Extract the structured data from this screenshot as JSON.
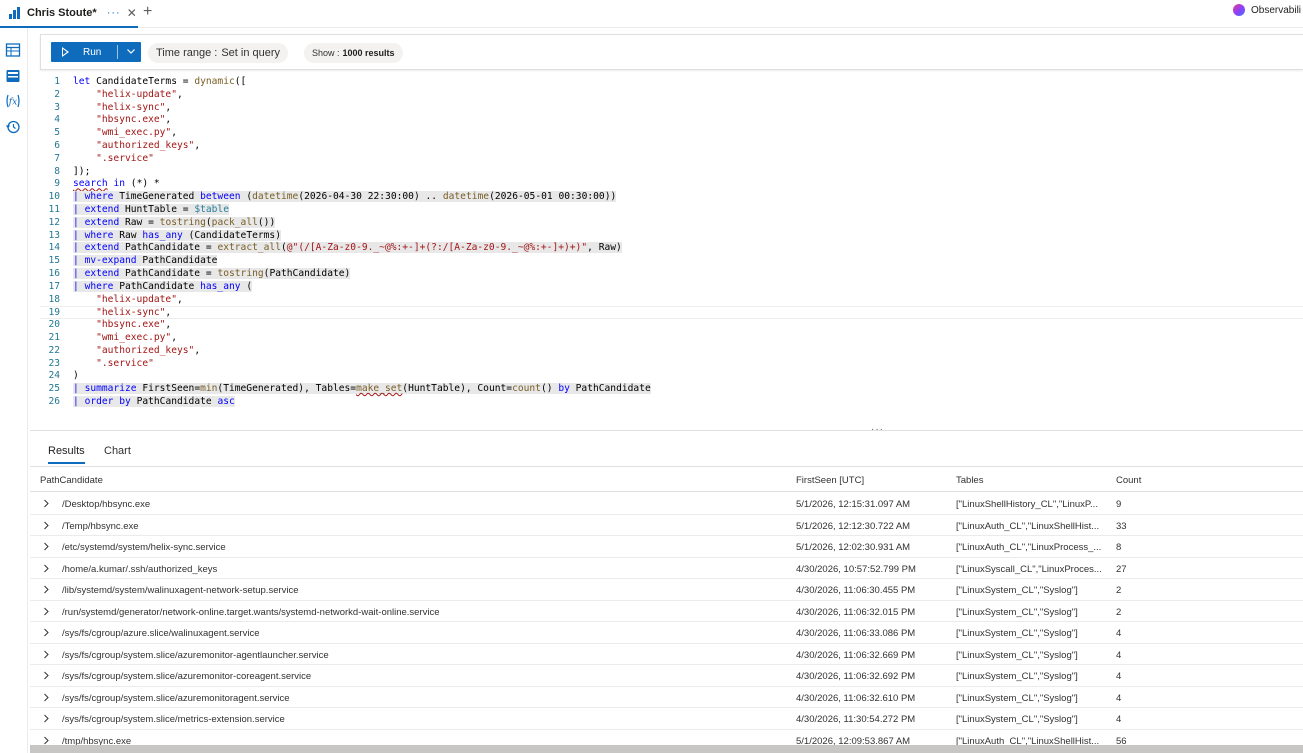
{
  "tab": {
    "title": "Chris Stoute*",
    "dots": "···",
    "close": "✕",
    "add": "+"
  },
  "brand": {
    "label": "Observabili",
    "accent": "#0f6cbd"
  },
  "rail": {
    "icons": [
      "table-icon",
      "storage-icon",
      "function-icon",
      "history-icon"
    ]
  },
  "toolbar": {
    "run_label": "Run",
    "time_range_label": "Time range :",
    "time_range_value": "Set in query",
    "show_label": "Show :",
    "show_value": "1000 results"
  },
  "editor": {
    "current_line": 19,
    "lines": [
      {
        "n": "1",
        "t": "let CandidateTerms = dynamic(["
      },
      {
        "n": "2",
        "t": "    \"helix-update\","
      },
      {
        "n": "3",
        "t": "    \"helix-sync\","
      },
      {
        "n": "4",
        "t": "    \"hbsync.exe\","
      },
      {
        "n": "5",
        "t": "    \"wmi_exec.py\","
      },
      {
        "n": "6",
        "t": "    \"authorized_keys\","
      },
      {
        "n": "7",
        "t": "    \".service\""
      },
      {
        "n": "8",
        "t": "]);"
      },
      {
        "n": "9",
        "t": "search in (*) *"
      },
      {
        "n": "10",
        "t": "| where TimeGenerated between (datetime(2026-04-30 22:30:00) .. datetime(2026-05-01 00:30:00))"
      },
      {
        "n": "11",
        "t": "| extend HuntTable = $table"
      },
      {
        "n": "12",
        "t": "| extend Raw = tostring(pack_all())"
      },
      {
        "n": "13",
        "t": "| where Raw has_any (CandidateTerms)"
      },
      {
        "n": "14",
        "t": "| extend PathCandidate = extract_all(@\"(/[A-Za-z0-9._~@%:+-]+(?:/[A-Za-z0-9._~@%:+-]+)+)\", Raw)"
      },
      {
        "n": "15",
        "t": "| mv-expand PathCandidate"
      },
      {
        "n": "16",
        "t": "| extend PathCandidate = tostring(PathCandidate)"
      },
      {
        "n": "17",
        "t": "| where PathCandidate has_any ("
      },
      {
        "n": "18",
        "t": "    \"helix-update\","
      },
      {
        "n": "19",
        "t": "    \"helix-sync\","
      },
      {
        "n": "20",
        "t": "    \"hbsync.exe\","
      },
      {
        "n": "21",
        "t": "    \"wmi_exec.py\","
      },
      {
        "n": "22",
        "t": "    \"authorized_keys\","
      },
      {
        "n": "23",
        "t": "    \".service\""
      },
      {
        "n": "24",
        "t": ")"
      },
      {
        "n": "25",
        "t": "| summarize FirstSeen=min(TimeGenerated), Tables=make_set(HuntTable), Count=count() by PathCandidate"
      },
      {
        "n": "26",
        "t": "| order by PathCandidate asc"
      }
    ]
  },
  "results": {
    "tabs": [
      "Results",
      "Chart"
    ],
    "active_tab": "Results",
    "splitter_dots": "···",
    "columns": [
      "PathCandidate",
      "FirstSeen [UTC]",
      "Tables",
      "Count"
    ],
    "rows": [
      [
        "/Desktop/hbsync.exe",
        "5/1/2026, 12:15:31.097 AM",
        "[\"LinuxShellHistory_CL\",\"LinuxP...",
        "9"
      ],
      [
        "/Temp/hbsync.exe",
        "5/1/2026, 12:12:30.722 AM",
        "[\"LinuxAuth_CL\",\"LinuxShellHist...",
        "33"
      ],
      [
        "/etc/systemd/system/helix-sync.service",
        "5/1/2026, 12:02:30.931 AM",
        "[\"LinuxAuth_CL\",\"LinuxProcess_...",
        "8"
      ],
      [
        "/home/a.kumar/.ssh/authorized_keys",
        "4/30/2026, 10:57:52.799 PM",
        "[\"LinuxSyscall_CL\",\"LinuxProces...",
        "27"
      ],
      [
        "/lib/systemd/system/walinuxagent-network-setup.service",
        "4/30/2026, 11:06:30.455 PM",
        "[\"LinuxSystem_CL\",\"Syslog\"]",
        "2"
      ],
      [
        "/run/systemd/generator/network-online.target.wants/systemd-networkd-wait-online.service",
        "4/30/2026, 11:06:32.015 PM",
        "[\"LinuxSystem_CL\",\"Syslog\"]",
        "2"
      ],
      [
        "/sys/fs/cgroup/azure.slice/walinuxagent.service",
        "4/30/2026, 11:06:33.086 PM",
        "[\"LinuxSystem_CL\",\"Syslog\"]",
        "4"
      ],
      [
        "/sys/fs/cgroup/system.slice/azuremonitor-agentlauncher.service",
        "4/30/2026, 11:06:32.669 PM",
        "[\"LinuxSystem_CL\",\"Syslog\"]",
        "4"
      ],
      [
        "/sys/fs/cgroup/system.slice/azuremonitor-coreagent.service",
        "4/30/2026, 11:06:32.692 PM",
        "[\"LinuxSystem_CL\",\"Syslog\"]",
        "4"
      ],
      [
        "/sys/fs/cgroup/system.slice/azuremonitoragent.service",
        "4/30/2026, 11:06:32.610 PM",
        "[\"LinuxSystem_CL\",\"Syslog\"]",
        "4"
      ],
      [
        "/sys/fs/cgroup/system.slice/metrics-extension.service",
        "4/30/2026, 11:30:54.272 PM",
        "[\"LinuxSystem_CL\",\"Syslog\"]",
        "4"
      ],
      [
        "/tmp/hbsync.exe",
        "5/1/2026, 12:09:53.867 AM",
        "[\"LinuxAuth_CL\",\"LinuxShellHist...",
        "56"
      ]
    ]
  }
}
